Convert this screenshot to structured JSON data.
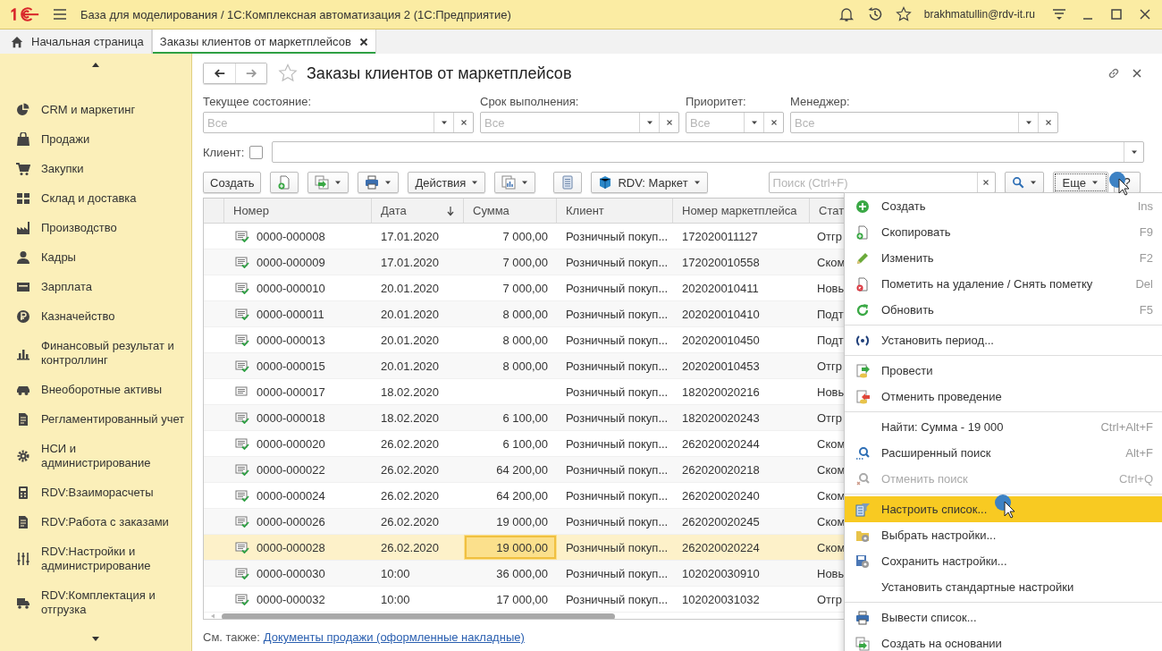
{
  "window": {
    "title": "База для моделирования / 1С:Комплексная автоматизация 2  (1С:Предприятие)",
    "user": "brakhmatullin@rdv-it.ru"
  },
  "tabs": [
    {
      "label": "Начальная страница",
      "selected": false,
      "kind": "home"
    },
    {
      "label": "Заказы клиентов от маркетплейсов",
      "selected": true,
      "kind": "document"
    }
  ],
  "sidebar": {
    "items": [
      {
        "label": "CRM и маркетинг"
      },
      {
        "label": "Продажи"
      },
      {
        "label": "Закупки"
      },
      {
        "label": "Склад и доставка"
      },
      {
        "label": "Производство"
      },
      {
        "label": "Кадры"
      },
      {
        "label": "Зарплата"
      },
      {
        "label": "Казначейство"
      },
      {
        "label": "Финансовый результат и контроллинг"
      },
      {
        "label": "Внеоборотные активы"
      },
      {
        "label": "Регламентированный учет"
      },
      {
        "label": "НСИ и администрирование"
      },
      {
        "label": "RDV:Взаиморасчеты"
      },
      {
        "label": "RDV:Работа с заказами"
      },
      {
        "label": "RDV:Настройки и администрирование"
      },
      {
        "label": "RDV:Комплектация и отгрузка"
      }
    ]
  },
  "form": {
    "title": "Заказы клиентов от маркетплейсов",
    "filters": [
      {
        "label": "Текущее состояние:",
        "placeholder": "Все"
      },
      {
        "label": "Срок выполнения:",
        "placeholder": "Все"
      },
      {
        "label": "Приоритет:",
        "placeholder": "Все"
      },
      {
        "label": "Менеджер:",
        "placeholder": "Все"
      }
    ],
    "client": {
      "label": "Клиент:",
      "checked": false
    },
    "toolbar": {
      "create": "Создать",
      "actions": "Действия",
      "market": "RDV: Маркет",
      "search_placeholder": "Поиск (Ctrl+F)",
      "more": "Еще",
      "help": "?"
    },
    "table": {
      "columns": [
        "Номер",
        "Дата",
        "Сумма",
        "Клиент",
        "Номер маркетплейса",
        "Стат"
      ],
      "rows": [
        {
          "number": "0000-000008",
          "date": "17.01.2020",
          "sum": "7 000,00",
          "client": "Розничный покуп...",
          "mp": "172020011127",
          "status": "Отгр",
          "posted": true,
          "selected": false
        },
        {
          "number": "0000-000009",
          "date": "17.01.2020",
          "sum": "7 000,00",
          "client": "Розничный покуп...",
          "mp": "172020010558",
          "status": "Ском",
          "posted": true,
          "selected": false
        },
        {
          "number": "0000-000010",
          "date": "20.01.2020",
          "sum": "7 000,00",
          "client": "Розничный покуп...",
          "mp": "202020010411",
          "status": "Новы",
          "posted": true,
          "selected": false
        },
        {
          "number": "0000-000011",
          "date": "20.01.2020",
          "sum": "8 000,00",
          "client": "Розничный покуп...",
          "mp": "202020010410",
          "status": "Подт",
          "posted": true,
          "selected": false
        },
        {
          "number": "0000-000013",
          "date": "20.01.2020",
          "sum": "8 000,00",
          "client": "Розничный покуп...",
          "mp": "202020010450",
          "status": "Подт",
          "posted": true,
          "selected": false
        },
        {
          "number": "0000-000015",
          "date": "20.01.2020",
          "sum": "8 000,00",
          "client": "Розничный покуп...",
          "mp": "202020010453",
          "status": "Отгр",
          "posted": true,
          "selected": false
        },
        {
          "number": "0000-000017",
          "date": "18.02.2020",
          "client": "Розничный покуп...",
          "mp": "182020020216",
          "status": "Новы",
          "posted": false,
          "selected": false
        },
        {
          "number": "0000-000018",
          "date": "18.02.2020",
          "sum": "6 100,00",
          "client": "Розничный покуп...",
          "mp": "182020020243",
          "status": "Отгр",
          "posted": true,
          "selected": false
        },
        {
          "number": "0000-000020",
          "date": "26.02.2020",
          "sum": "6 100,00",
          "client": "Розничный покуп...",
          "mp": "262020020244",
          "status": "Ском",
          "posted": true,
          "selected": false
        },
        {
          "number": "0000-000022",
          "date": "26.02.2020",
          "sum": "64 200,00",
          "client": "Розничный покуп...",
          "mp": "262020020218",
          "status": "Ском",
          "posted": true,
          "selected": false
        },
        {
          "number": "0000-000024",
          "date": "26.02.2020",
          "sum": "64 200,00",
          "client": "Розничный покуп...",
          "mp": "262020020240",
          "status": "Ском",
          "posted": true,
          "selected": false
        },
        {
          "number": "0000-000026",
          "date": "26.02.2020",
          "sum": "19 000,00",
          "client": "Розничный покуп...",
          "mp": "262020020245",
          "status": "Ском",
          "posted": true,
          "selected": false
        },
        {
          "number": "0000-000028",
          "date": "26.02.2020",
          "sum": "19 000,00",
          "client": "Розничный покуп...",
          "mp": "262020020224",
          "status": "Ском",
          "posted": true,
          "selected": true
        },
        {
          "number": "0000-000030",
          "date": "10:00",
          "sum": "36 000,00",
          "client": "Розничный покуп...",
          "mp": "102020030910",
          "status": "Новы",
          "posted": true,
          "selected": false
        },
        {
          "number": "0000-000032",
          "date": "10:00",
          "sum": "17 000,00",
          "client": "Розничный покуп...",
          "mp": "102020031032",
          "status": "Отгр",
          "posted": true,
          "selected": false
        }
      ]
    },
    "see_also": {
      "label": "См. также:",
      "link": "Документы продажи (оформленные накладные)"
    }
  },
  "menu": {
    "groups": [
      [
        {
          "label": "Создать",
          "shortcut": "Ins",
          "kind": "create",
          "disabled": false,
          "selected": false
        },
        {
          "label": "Скопировать",
          "shortcut": "F9",
          "kind": "copy",
          "disabled": false,
          "selected": false
        },
        {
          "label": "Изменить",
          "shortcut": "F2",
          "kind": "edit",
          "disabled": false,
          "selected": false
        },
        {
          "label": "Пометить на удаление / Снять пометку",
          "shortcut": "Del",
          "kind": "delete",
          "disabled": false,
          "selected": false
        },
        {
          "label": "Обновить",
          "shortcut": "F5",
          "kind": "refresh",
          "disabled": false,
          "selected": false
        }
      ],
      [
        {
          "label": "Установить период...",
          "kind": "period",
          "disabled": false,
          "selected": false
        }
      ],
      [
        {
          "label": "Провести",
          "kind": "post",
          "disabled": false,
          "selected": false
        },
        {
          "label": "Отменить проведение",
          "kind": "unpost",
          "disabled": false,
          "selected": false
        }
      ],
      [
        {
          "label": "Найти: Сумма - 19 000",
          "shortcut": "Ctrl+Alt+F",
          "kind": "find",
          "disabled": false,
          "selected": false
        },
        {
          "label": "Расширенный поиск",
          "shortcut": "Alt+F",
          "kind": "search",
          "disabled": false,
          "selected": false
        },
        {
          "label": "Отменить поиск",
          "shortcut": "Ctrl+Q",
          "kind": "cancel",
          "disabled": true,
          "selected": false
        }
      ],
      [
        {
          "label": "Настроить список...",
          "kind": "customize",
          "disabled": false,
          "selected": true
        },
        {
          "label": "Выбрать настройки...",
          "kind": "load",
          "disabled": false,
          "selected": false
        },
        {
          "label": "Сохранить настройки...",
          "kind": "save",
          "disabled": false,
          "selected": false
        },
        {
          "label": "Установить стандартные настройки",
          "kind": "reset",
          "disabled": false,
          "selected": false
        }
      ],
      [
        {
          "label": "Вывести список...",
          "kind": "print",
          "disabled": false,
          "selected": false
        },
        {
          "label": "Создать на основании",
          "kind": "generate",
          "disabled": false,
          "selected": false
        }
      ]
    ]
  }
}
